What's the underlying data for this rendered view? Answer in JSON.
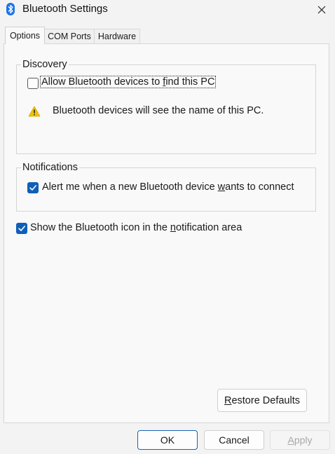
{
  "window": {
    "title": "Bluetooth Settings",
    "icon": "bluetooth-icon"
  },
  "tabs": [
    {
      "label": "Options",
      "selected": true
    },
    {
      "label": "COM Ports",
      "selected": false
    },
    {
      "label": "Hardware",
      "selected": false
    }
  ],
  "discovery": {
    "legend": "Discovery",
    "allow_checkbox": {
      "label_before": "Allow Bluetooth devices to ",
      "mnemonic": "f",
      "label_after": "ind this PC",
      "checked": false
    },
    "warning_text": "Bluetooth devices will see the name of this PC."
  },
  "notifications": {
    "legend": "Notifications",
    "alert_checkbox": {
      "label_before": "Alert me when a new Bluetooth device ",
      "mnemonic": "w",
      "label_after": "ants to connect",
      "checked": true
    }
  },
  "show_icon_checkbox": {
    "label_before": "Show the Bluetooth icon in the ",
    "mnemonic": "n",
    "label_after": "otification area",
    "checked": true
  },
  "buttons": {
    "restore_before": "",
    "restore_mnemonic": "R",
    "restore_after": "estore Defaults",
    "ok": "OK",
    "cancel": "Cancel",
    "apply_mnemonic": "A",
    "apply_after": "pply"
  },
  "colors": {
    "accent": "#0f5fb8",
    "warning": "#f2c200"
  }
}
